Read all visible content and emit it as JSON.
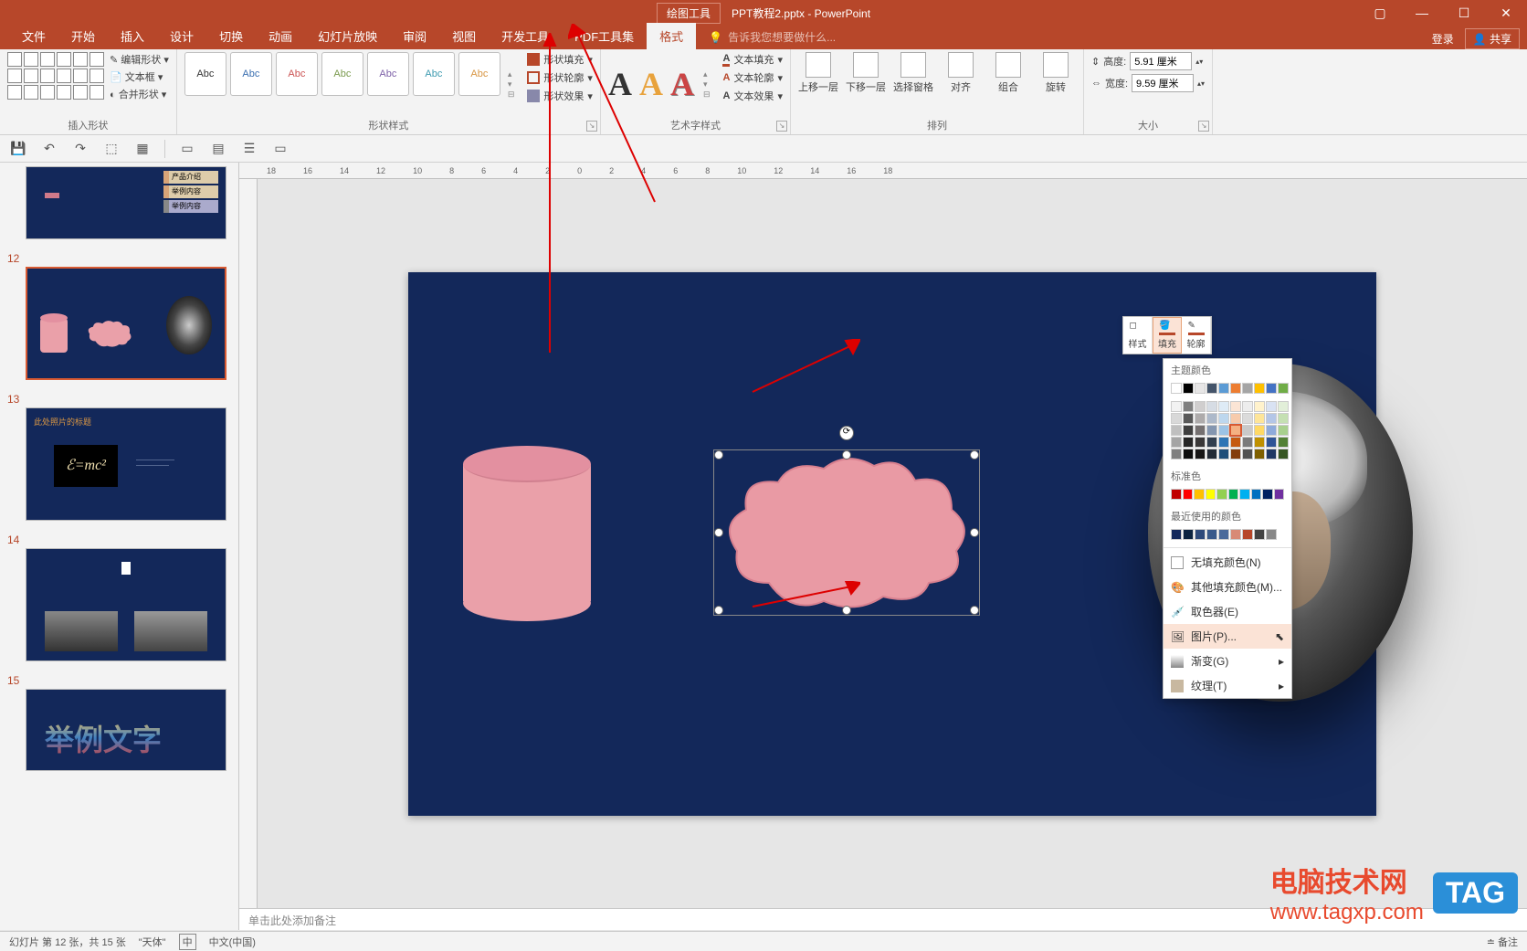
{
  "titlebar": {
    "drawing_tools": "绘图工具",
    "filename": "PPT教程2.pptx - PowerPoint"
  },
  "menubar": {
    "tabs": [
      "文件",
      "开始",
      "插入",
      "设计",
      "切换",
      "动画",
      "幻灯片放映",
      "审阅",
      "视图",
      "开发工具",
      "PDF工具集",
      "格式"
    ],
    "active_index": 11,
    "tell_me": "告诉我您想要做什么...",
    "login": "登录",
    "share": "共享"
  },
  "ribbon": {
    "insert_shapes": {
      "label": "插入形状",
      "edit_shape": "编辑形状",
      "text_box": "文本框",
      "merge_shapes": "合并形状"
    },
    "shape_styles": {
      "label": "形状样式",
      "abc": "Abc",
      "shape_fill": "形状填充",
      "shape_outline": "形状轮廓",
      "shape_effects": "形状效果"
    },
    "wordart": {
      "label": "艺术字样式",
      "text_fill": "文本填充",
      "text_outline": "文本轮廓",
      "text_effects": "文本效果"
    },
    "arrange": {
      "label": "排列",
      "bring_forward": "上移一层",
      "send_backward": "下移一层",
      "selection_pane": "选择窗格",
      "align": "对齐",
      "group": "组合",
      "rotate": "旋转"
    },
    "size": {
      "label": "大小",
      "height_label": "高度:",
      "width_label": "宽度:",
      "height_val": "5.91 厘米",
      "width_val": "9.59 厘米"
    }
  },
  "thumbs": {
    "t11_items": [
      "产品介绍",
      "举例内容",
      "举例内容"
    ],
    "t13_label": "此处照片的标题",
    "t13_emc": "ℰ=mc²",
    "t15_txt": "举例文字",
    "numbers": [
      "12",
      "13",
      "14",
      "15"
    ]
  },
  "mini_toolbar": {
    "style": "样式",
    "fill": "填充",
    "outline": "轮廓"
  },
  "fill_dropdown": {
    "theme_colors": "主题颜色",
    "standard_colors": "标准色",
    "recent_colors": "最近使用的颜色",
    "no_fill": "无填充颜色(N)",
    "more_colors": "其他填充颜色(M)...",
    "eyedropper": "取色器(E)",
    "picture": "图片(P)...",
    "gradient": "渐变(G)",
    "texture": "纹理(T)",
    "colors": {
      "theme_row1": [
        "#ffffff",
        "#000000",
        "#e7e6e6",
        "#44546a",
        "#5b9bd5",
        "#ed7d31",
        "#a5a5a5",
        "#ffc000",
        "#4472c4",
        "#70ad47"
      ],
      "theme_shades": [
        [
          "#f2f2f2",
          "#7f7f7f",
          "#d0cece",
          "#d6dce4",
          "#deebf6",
          "#fbe5d5",
          "#ededed",
          "#fff2cc",
          "#d9e2f3",
          "#e2efd9"
        ],
        [
          "#d8d8d8",
          "#595959",
          "#aeabab",
          "#adb9ca",
          "#bdd7ee",
          "#f7cbac",
          "#dbdbdb",
          "#fee599",
          "#b4c6e7",
          "#c5e0b3"
        ],
        [
          "#bfbfbf",
          "#3f3f3f",
          "#757070",
          "#8496b0",
          "#9cc3e5",
          "#f4b183",
          "#c9c9c9",
          "#ffd965",
          "#8eaadb",
          "#a8d08d"
        ],
        [
          "#a5a5a5",
          "#262626",
          "#3a3838",
          "#323f4f",
          "#2e75b5",
          "#c55a11",
          "#7b7b7b",
          "#bf9000",
          "#2f5496",
          "#538135"
        ],
        [
          "#7f7f7f",
          "#0c0c0c",
          "#171616",
          "#222a35",
          "#1e4e79",
          "#833c0b",
          "#525252",
          "#7f6000",
          "#1f3864",
          "#375623"
        ]
      ],
      "standard": [
        "#c00000",
        "#ff0000",
        "#ffc000",
        "#ffff00",
        "#92d050",
        "#00b050",
        "#00b0f0",
        "#0070c0",
        "#002060",
        "#7030a0"
      ],
      "recent": [
        "#13285a",
        "#0c2340",
        "#2e4a7a",
        "#3a5a8a",
        "#4a6a9a",
        "#d88a76",
        "#b7472a",
        "#444444",
        "#888888"
      ],
      "selected_theme": [
        2,
        5
      ]
    }
  },
  "notes": "单击此处添加备注",
  "statusbar": {
    "slide_info": "幻灯片 第 12 张，共 15 张",
    "theme": "\"天体\"",
    "lang_icon": "中",
    "lang": "中文(中国)",
    "notes_btn": "备注"
  },
  "watermark": {
    "text": "电脑技术网",
    "url": "www.tagxp.com",
    "tag": "TAG"
  },
  "ruler_ticks": [
    "18",
    "16",
    "14",
    "12",
    "10",
    "8",
    "6",
    "4",
    "2",
    "0",
    "2",
    "4",
    "6",
    "8",
    "10",
    "12",
    "14",
    "16",
    "18"
  ]
}
